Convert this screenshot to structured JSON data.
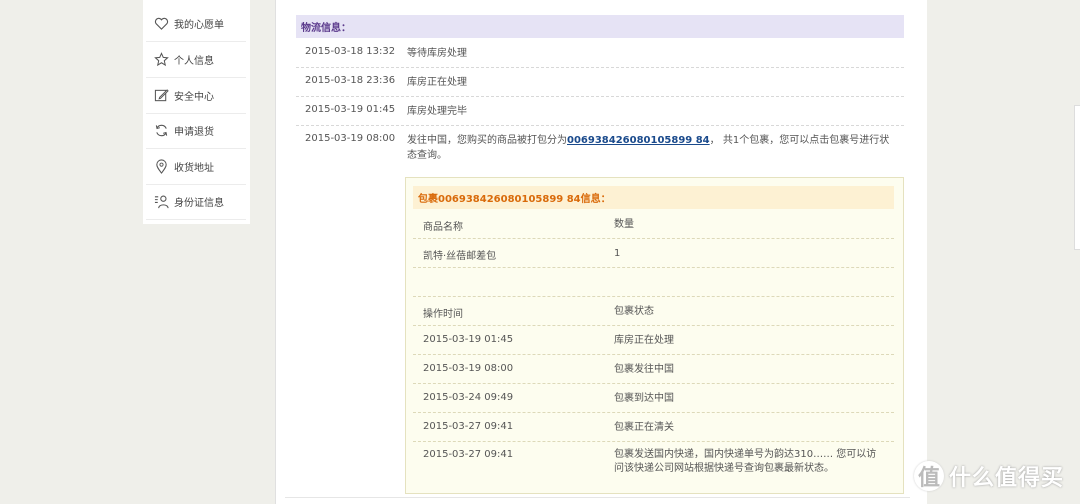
{
  "sidebar": {
    "items": [
      {
        "label": "我的心愿单",
        "icon": "heart-icon"
      },
      {
        "label": "个人信息",
        "icon": "star-icon"
      },
      {
        "label": "安全中心",
        "icon": "edit-icon"
      },
      {
        "label": "申请退货",
        "icon": "refresh-icon"
      },
      {
        "label": "收货地址",
        "icon": "location-pin-icon"
      },
      {
        "label": "身份证信息",
        "icon": "id-person-icon"
      }
    ]
  },
  "logistics": {
    "title": "物流信息：",
    "rows": [
      {
        "time": "2015-03-18 13:32",
        "msg": "等待库房处理"
      },
      {
        "time": "2015-03-18 23:36",
        "msg": "库房正在处理"
      },
      {
        "time": "2015-03-19 01:45",
        "msg": "库房处理完毕"
      },
      {
        "time": "2015-03-19 08:00",
        "msg_pre": "发往中国，您购买的商品被打包分为",
        "tracking": "006938426080105899 84",
        "msg_post": "， 共1个包裹，您可以点击包裹号进行状态查询。"
      }
    ]
  },
  "package": {
    "title": "包裹006938426080105899 84信息：",
    "header1": {
      "c1": "商品名称",
      "c2": "数量"
    },
    "item": {
      "c1": "凯特·丝蓓邮差包",
      "c2": "1"
    },
    "header2": {
      "c1": "操作时间",
      "c2": "包裹状态"
    },
    "events": [
      {
        "time": "2015-03-19 01:45",
        "status": "库房正在处理"
      },
      {
        "time": "2015-03-19 08:00",
        "status": "包裹发往中国"
      },
      {
        "time": "2015-03-24 09:49",
        "status": "包裹到达中国"
      },
      {
        "time": "2015-03-27 09:41",
        "status": "包裹正在清关"
      },
      {
        "time": "2015-03-27 09:41",
        "status": "包裹发送国内快递，国内快递单号为韵达310…… 您可以访问该快递公司网站根据快递号查询包裹最新状态。"
      }
    ]
  },
  "watermark": {
    "logo": "值",
    "text": "什么值得买"
  }
}
